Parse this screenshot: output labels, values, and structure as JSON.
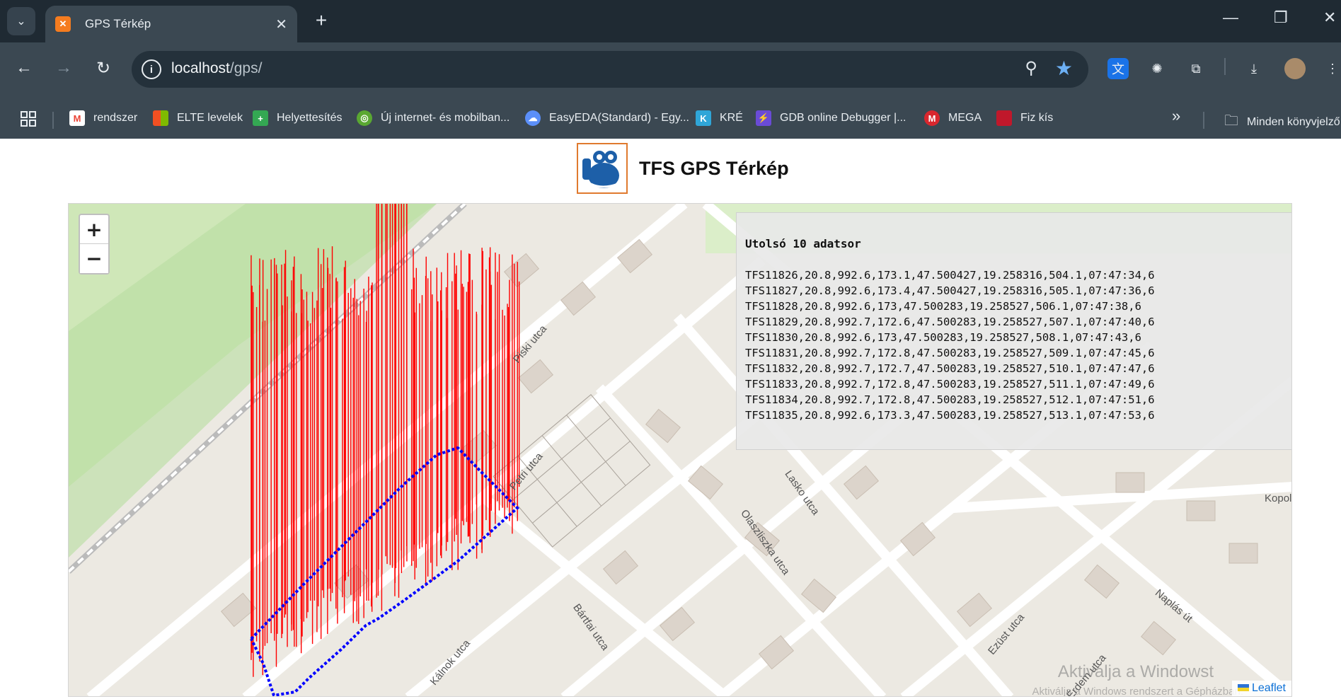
{
  "browser": {
    "tab_title": "GPS Térkép",
    "url_host": "localhost",
    "url_path": "/gps/",
    "bookmarks": [
      {
        "label": "rendszer",
        "icon": "gmail-icon",
        "color": "#ea4335"
      },
      {
        "label": "ELTE levelek",
        "icon": "microsoft-icon",
        "color": "#f25022"
      },
      {
        "label": "Helyettesítés",
        "icon": "plus-icon",
        "color": "#34a853"
      },
      {
        "label": "Új internet- és mobilban...",
        "icon": "bank-icon",
        "color": "#5aa832"
      },
      {
        "label": "EasyEDA(Standard) - Egy...",
        "icon": "cloud-icon",
        "color": "#5b8ff9"
      },
      {
        "label": "KRÉ",
        "icon": "k-icon",
        "color": "#2fa6d8"
      },
      {
        "label": "GDB online Debugger |...",
        "icon": "bolt-icon",
        "color": "#6a4bd6"
      },
      {
        "label": "MEGA",
        "icon": "mega-icon",
        "color": "#d9272e"
      },
      {
        "label": "Fiz kís",
        "icon": "fiz-icon",
        "color": "#c0182b"
      }
    ],
    "all_bookmarks": "Minden könyvjelző"
  },
  "page": {
    "title": "TFS GPS Térkép"
  },
  "panel": {
    "heading": "Utolsó 10 adatsor",
    "rows": [
      "TFS11826,20.8,992.6,173.1,47.500427,19.258316,504.1,07:47:34,6",
      "TFS11827,20.8,992.6,173.4,47.500427,19.258316,505.1,07:47:36,6",
      "TFS11828,20.8,992.6,173,47.500283,19.258527,506.1,07:47:38,6",
      "TFS11829,20.8,992.7,172.6,47.500283,19.258527,507.1,07:47:40,6",
      "TFS11830,20.8,992.6,173,47.500283,19.258527,508.1,07:47:43,6",
      "TFS11831,20.8,992.7,172.8,47.500283,19.258527,509.1,07:47:45,6",
      "TFS11832,20.8,992.7,172.7,47.500283,19.258527,510.1,07:47:47,6",
      "TFS11833,20.8,992.7,172.8,47.500283,19.258527,511.1,07:47:49,6",
      "TFS11834,20.8,992.7,172.8,47.500283,19.258527,512.1,07:47:51,6",
      "TFS11835,20.8,992.6,173.3,47.500283,19.258527,513.1,07:47:53,6"
    ]
  },
  "map": {
    "zoom_in": "+",
    "zoom_out": "−",
    "attribution": "Leaflet",
    "streets": [
      "Piski utca",
      "Petri utca",
      "Bártfai utca",
      "Kálnok utca",
      "Lasko utca",
      "Olaszliszka utca",
      "Ezüst utca",
      "Naplás út",
      "Érdem utca",
      "Kopol"
    ],
    "track_color": "#0000ff",
    "altitude_color": "#ff0000"
  },
  "os": {
    "watermark": "Aktiválja a Windowst",
    "watermark_sub": "Aktiválja a Windows rendszert a Gépházban."
  }
}
